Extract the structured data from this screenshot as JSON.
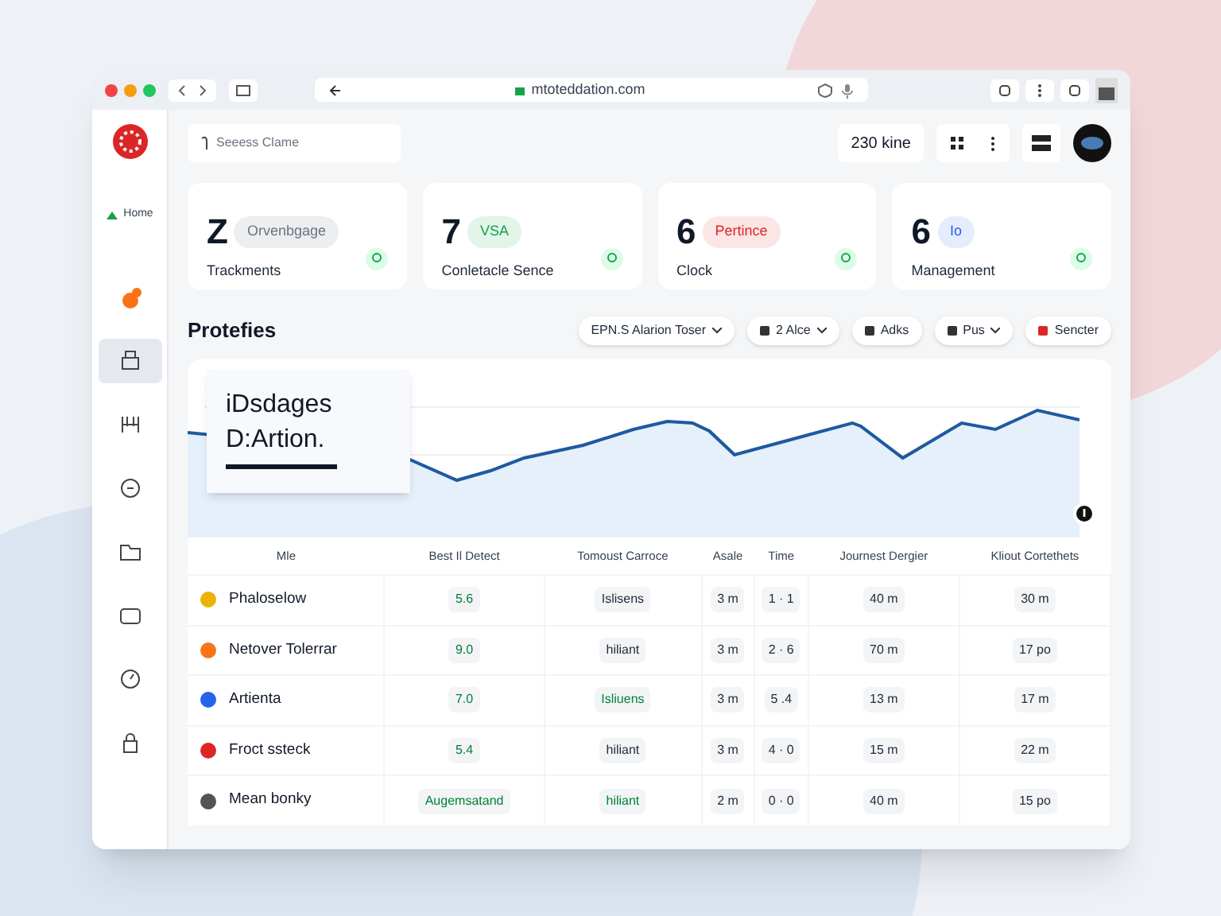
{
  "browser": {
    "url": "mtoteddation.com"
  },
  "topbar": {
    "search": {
      "placeholder": "Seeess Clame"
    },
    "time": "230 kine"
  },
  "sidebar": {
    "items": [
      {
        "label": "Home",
        "selected": false
      },
      {
        "selected": false
      },
      {
        "selected": true
      },
      {
        "selected": false
      },
      {
        "selected": false
      },
      {
        "selected": false
      },
      {
        "selected": false
      },
      {
        "selected": false
      },
      {
        "selected": false
      }
    ]
  },
  "cards": [
    {
      "value": "Z",
      "tag": "Orvenbgage",
      "color": "#6b7280",
      "label": "Trackments"
    },
    {
      "value": "7",
      "tag": "VSA",
      "color": "#16a34a",
      "label": "Conletacle Sence"
    },
    {
      "value": "6",
      "tag": "Pertince",
      "color": "#dc2626",
      "label": "Clock"
    },
    {
      "value": "6",
      "tag": "Io",
      "color": "#2563eb",
      "label": "Management"
    }
  ],
  "section": {
    "title": "Protefies",
    "filters": [
      {
        "label": "EPN.S Alarion Toser",
        "dropdown": true
      },
      {
        "label": "2 Alce",
        "dropdown": true
      },
      {
        "label": "Adks",
        "dropdown": false
      },
      {
        "label": "Pus",
        "dropdown": true
      },
      {
        "label": "Sencter",
        "dropdown": false
      }
    ]
  },
  "chart": {
    "legend": [
      "iDsdages",
      "D:Artion."
    ]
  },
  "table": {
    "columns": [
      "Mle",
      "Best Il Detect",
      "Tomoust Carroce",
      "Asale",
      "Time",
      "Journest Dergier",
      "Kliout Cortethets"
    ],
    "rows": [
      {
        "color": "#eab308",
        "cells": [
          "Phaloselow",
          "5.6",
          "Islisens",
          "3 m",
          "1 · 1",
          "40 m",
          "30 m"
        ]
      },
      {
        "color": "#f97316",
        "cells": [
          "Netover Tolerrar",
          "9.0",
          "hiliant",
          "3 m",
          "2 · 6",
          "70 m",
          "17 po"
        ]
      },
      {
        "color": "#2563eb",
        "cells": [
          "Artienta",
          "7.0",
          "Isliuens",
          "3 m",
          "5 .4",
          "13 m",
          "17 m"
        ]
      },
      {
        "color": "#dc2626",
        "cells": [
          "Froct ssteck",
          "5.4",
          "hiliant",
          "3 m",
          "4 · 0",
          "15 m",
          "22 m"
        ]
      },
      {
        "color": "#57534e",
        "cells": [
          "Mean bonky",
          "Augemsatand",
          "hiliant",
          "2 m",
          "0 · 0",
          "40 m",
          "15 po"
        ]
      }
    ]
  }
}
